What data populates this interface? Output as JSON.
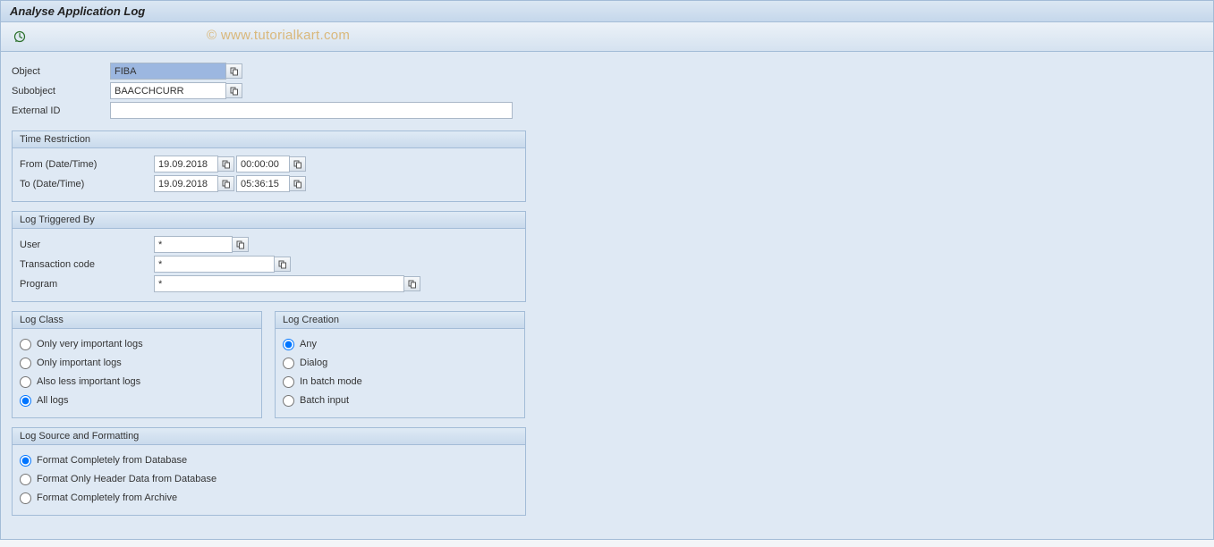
{
  "header": {
    "title": "Analyse Application Log"
  },
  "watermark": "© www.tutorialkart.com",
  "filters": {
    "object_label": "Object",
    "object_value": "FIBA",
    "subobject_label": "Subobject",
    "subobject_value": "BAACCHCURR",
    "externalid_label": "External ID",
    "externalid_value": ""
  },
  "time": {
    "group_title": "Time Restriction",
    "from_label": "From (Date/Time)",
    "from_date": "19.09.2018",
    "from_time": "00:00:00",
    "to_label": "To (Date/Time)",
    "to_date": "19.09.2018",
    "to_time": "05:36:15"
  },
  "trigger": {
    "group_title": "Log Triggered By",
    "user_label": "User",
    "user_value": "*",
    "tcode_label": "Transaction code",
    "tcode_value": "*",
    "program_label": "Program",
    "program_value": "*"
  },
  "logclass": {
    "group_title": "Log Class",
    "opt1": "Only very important logs",
    "opt2": "Only important logs",
    "opt3": "Also less important logs",
    "opt4": "All logs"
  },
  "logcreation": {
    "group_title": "Log Creation",
    "opt1": "Any",
    "opt2": "Dialog",
    "opt3": "In batch mode",
    "opt4": "Batch input"
  },
  "source": {
    "group_title": "Log Source and Formatting",
    "opt1": "Format Completely from Database",
    "opt2": "Format Only Header Data from Database",
    "opt3": "Format Completely from Archive"
  }
}
